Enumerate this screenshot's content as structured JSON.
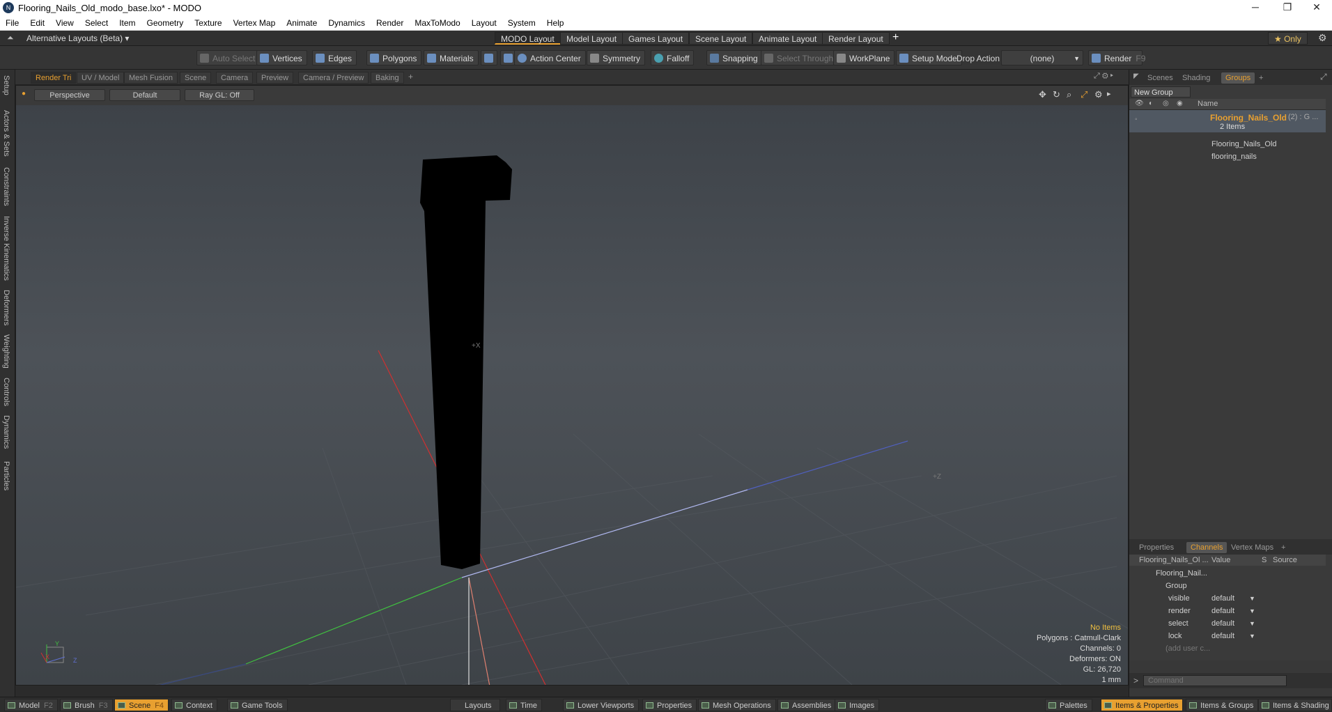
{
  "window": {
    "title": "Flooring_Nails_Old_modo_base.lxo* - MODO",
    "logo": "N",
    "minimize": "─",
    "maximize": "❐",
    "close": "✕"
  },
  "menu": [
    "File",
    "Edit",
    "View",
    "Select",
    "Item",
    "Geometry",
    "Texture",
    "Vertex Map",
    "Animate",
    "Dynamics",
    "Render",
    "MaxToModo",
    "Layout",
    "System",
    "Help"
  ],
  "layoutbar": {
    "alt_layouts": "Alternative Layouts (Beta) ▾",
    "tabs": [
      "MODO Layout",
      "Model Layout",
      "Games Layout",
      "Scene Layout",
      "Animate Layout",
      "Render Layout"
    ],
    "add": "+",
    "only": "★  Only",
    "gear": "⚙"
  },
  "toolbar": {
    "auto_select": "Auto Select",
    "vertices": "Vertices",
    "edges": "Edges",
    "polygons": "Polygons",
    "materials": "Materials",
    "action_center": "Action Center",
    "symmetry": "Symmetry",
    "falloff": "Falloff",
    "snapping": "Snapping",
    "select_through": "Select Through",
    "workplane": "WorkPlane",
    "setup_mode": "Setup Mode",
    "drop_action": "Drop Action",
    "drop_value": "(none)",
    "render": "Render",
    "render_key": "F9"
  },
  "left_tabs": [
    "Setup",
    "Actors & Sets",
    "Constraints",
    "Inverse Kinematics",
    "Deformers",
    "Weighting",
    "Controls",
    "Dynamics",
    "Particles"
  ],
  "viewport_tabs": [
    "Render Tri",
    "UV / Model",
    "Mesh Fusion",
    "Scene",
    "Camera",
    "Preview",
    "Camera / Preview",
    "Baking"
  ],
  "viewport_tab_add": "+",
  "viewport_opts": {
    "view": "Perspective",
    "shading": "Default",
    "raygl": "Ray GL: Off"
  },
  "viewport_info": {
    "items": "No Items",
    "polygons": "Polygons : Catmull-Clark",
    "channels": "Channels: 0",
    "deformers": "Deformers: ON",
    "gl": "GL: 26,720",
    "unit": "1 mm"
  },
  "axis_labels": {
    "x": "+X",
    "z": "+Z",
    "gx": "X",
    "gy": "Y",
    "gz": "Z"
  },
  "colors": {
    "accent": "#e8a030",
    "x_axis": "#d03030",
    "y_axis": "#40c040",
    "z_axis": "#6070d0"
  },
  "groups_panel": {
    "tabs": [
      "Scenes",
      "Shading",
      "Groups"
    ],
    "add": "+",
    "new_group": "New Group",
    "col_name": "Name",
    "group_name": "Flooring_Nails_Old",
    "group_suffix": "(2) : G ...",
    "group_count": "2 Items",
    "children": [
      "Flooring_Nails_Old",
      "flooring_nails"
    ]
  },
  "channels_panel": {
    "tabs": [
      "Properties",
      "Channels",
      "Vertex Maps"
    ],
    "add": "+",
    "col_item": "Flooring_Nails_Ol ...",
    "col_value": "Value",
    "col_s": "S",
    "col_source": "Source",
    "root": "Flooring_Nail...",
    "group": "Group",
    "rows": [
      {
        "name": "visible",
        "value": "default"
      },
      {
        "name": "render",
        "value": "default"
      },
      {
        "name": "select",
        "value": "default"
      },
      {
        "name": "lock",
        "value": "default"
      }
    ],
    "add_user": "(add user c..."
  },
  "command": {
    "prompt": ">",
    "placeholder": "Command"
  },
  "bottom": {
    "left": [
      {
        "label": "Model",
        "key": "F2"
      },
      {
        "label": "Brush",
        "key": "F3"
      },
      {
        "label": "Scene",
        "key": "F4"
      },
      {
        "label": "Context",
        "key": ""
      },
      {
        "label": "Game Tools",
        "key": ""
      }
    ],
    "center": [
      "Layouts",
      "Time",
      "Lower Viewports",
      "Properties",
      "Mesh Operations",
      "Assemblies",
      "Images"
    ],
    "right": [
      "Palettes",
      "Items & Properties",
      "Items & Groups",
      "Items & Shading"
    ]
  }
}
